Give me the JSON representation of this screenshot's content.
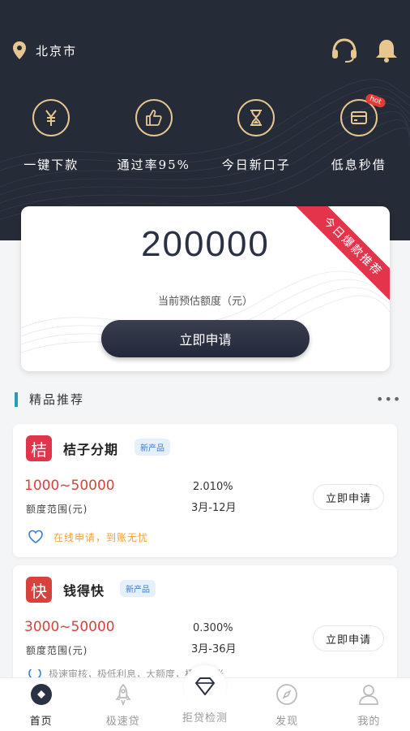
{
  "header": {
    "city": "北京市",
    "features": [
      {
        "icon": "yen-icon",
        "label": "一键下款"
      },
      {
        "icon": "thumbs-up-icon",
        "label": "通过率95%"
      },
      {
        "icon": "hourglass-icon",
        "label": "今日新口子"
      },
      {
        "icon": "card-icon",
        "label": "低息秒借",
        "badge": "hot"
      }
    ]
  },
  "hero": {
    "amount": "200000",
    "subtitle": "当前预估额度（元）",
    "apply_label": "立即申请",
    "ribbon": "今日爆款推荐"
  },
  "section": {
    "title": "精品推荐",
    "more": "•••"
  },
  "products": [
    {
      "logo": "桔",
      "logo_color": "#e2354b",
      "name": "桔子分期",
      "tag": "新产品",
      "range": "1000~50000",
      "range_label": "额度范围(元)",
      "rate": "2.010%",
      "term": "3月-12月",
      "apply_label": "立即申请",
      "slogan": "在线申请，到账无忧"
    },
    {
      "logo": "快",
      "logo_color": "#d9413c",
      "name": "钱得快",
      "tag": "新产品",
      "range": "3000~50000",
      "range_label": "额度范围(元)",
      "rate": "0.300%",
      "term": "3月-36月",
      "apply_label": "立即申请",
      "slogan": "极速审核，极低利息，大额度，极速到账"
    }
  ],
  "tabbar": [
    {
      "label": "首页",
      "icon": "home-icon",
      "active": true
    },
    {
      "label": "极速贷",
      "icon": "rocket-icon"
    },
    {
      "label": "拒贷检测",
      "icon": "diamond-icon"
    },
    {
      "label": "发现",
      "icon": "compass-icon"
    },
    {
      "label": "我的",
      "icon": "user-icon"
    }
  ],
  "colors": {
    "header_bg": "#262b38",
    "gold": "#e7c690",
    "ribbon": "#e2354b",
    "accent_bar": "#2a9bb5",
    "range_red": "#d9413c",
    "slogan_orange": "#f0a23a"
  }
}
